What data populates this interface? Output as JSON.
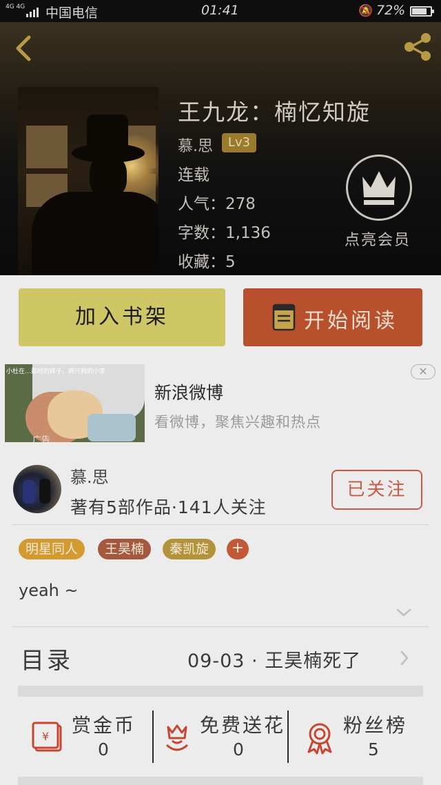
{
  "status_bar": {
    "signal": "4G 4G",
    "carrier": "中国电信",
    "time": "01:41",
    "battery": "72%"
  },
  "book": {
    "title": "王九龙：楠忆知旋",
    "author": "慕.思",
    "level": "Lv3",
    "status": "连载",
    "popularity": "人气：278",
    "word_count": "字数：1,136",
    "favorites": "收藏：5",
    "vip_label": "点亮会员"
  },
  "actions": {
    "add_to_shelf": "加入书架",
    "start_reading": "开始阅读"
  },
  "ad": {
    "title": "新浪微博",
    "description": "看微博，聚焦兴趣和热点",
    "thumb_caption": "小杜在…那时的样子，两只狗的小家",
    "tag": "广告",
    "close_icon": "close-icon"
  },
  "author_card": {
    "name": "慕.思",
    "stats": "著有5部作品·141人关注",
    "follow_label": "已关注",
    "tags": [
      "明星同人",
      "王昊楠",
      "秦凯旋"
    ],
    "tag_colors": [
      "#d39a2f",
      "#a5583e",
      "#b3933a"
    ],
    "tag_plus": "+",
    "intro": "yeah ~"
  },
  "toc": {
    "label": "目录",
    "latest": "09-03 · 王昊楠死了"
  },
  "stats": [
    {
      "label": "赏金币",
      "value": "0",
      "icon": "red-envelope-icon"
    },
    {
      "label": "免费送花",
      "value": "0",
      "icon": "flower-icon"
    },
    {
      "label": "粉丝榜",
      "value": "5",
      "icon": "medal-icon"
    }
  ],
  "colors": {
    "accent_orange": "#b8502e",
    "shelf_button": "#cfc766",
    "follow_red": "#c95a47",
    "level_gold": "#9a7a2c"
  }
}
